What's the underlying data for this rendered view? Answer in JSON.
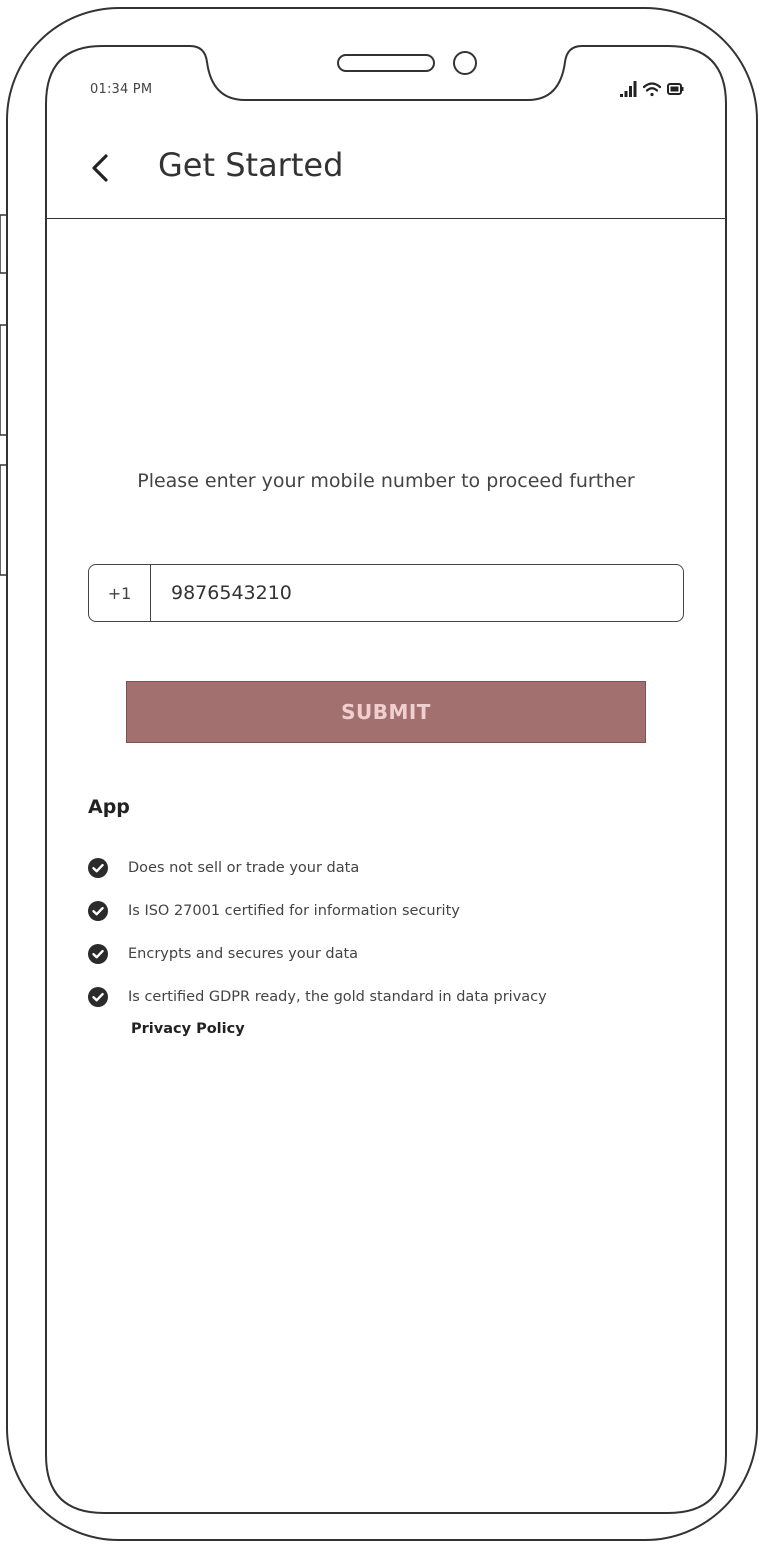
{
  "status_bar": {
    "time": "01:34 PM",
    "icons": [
      "signal-icon",
      "wifi-icon",
      "battery-icon"
    ]
  },
  "header": {
    "back_icon": "chevron-left-icon",
    "title": "Get Started"
  },
  "main": {
    "instruction": "Please enter your mobile number to proceed further",
    "country_code": "+1",
    "phone_value": "9876543210",
    "submit_label": "SUBMIT"
  },
  "app_section": {
    "heading": "App",
    "check_icon": "check-circle-icon",
    "features": [
      {
        "text": "Does not sell or trade your data"
      },
      {
        "text": "Is ISO 27001 certified for information security"
      },
      {
        "text": "Encrypts and secures your data"
      },
      {
        "text": "Is certified GDPR ready, the gold standard in data privacy"
      }
    ],
    "privacy_link": "Privacy Policy"
  },
  "colors": {
    "submit_bg": "#a37070",
    "submit_text": "#f1cfcf",
    "outline": "#333333"
  }
}
